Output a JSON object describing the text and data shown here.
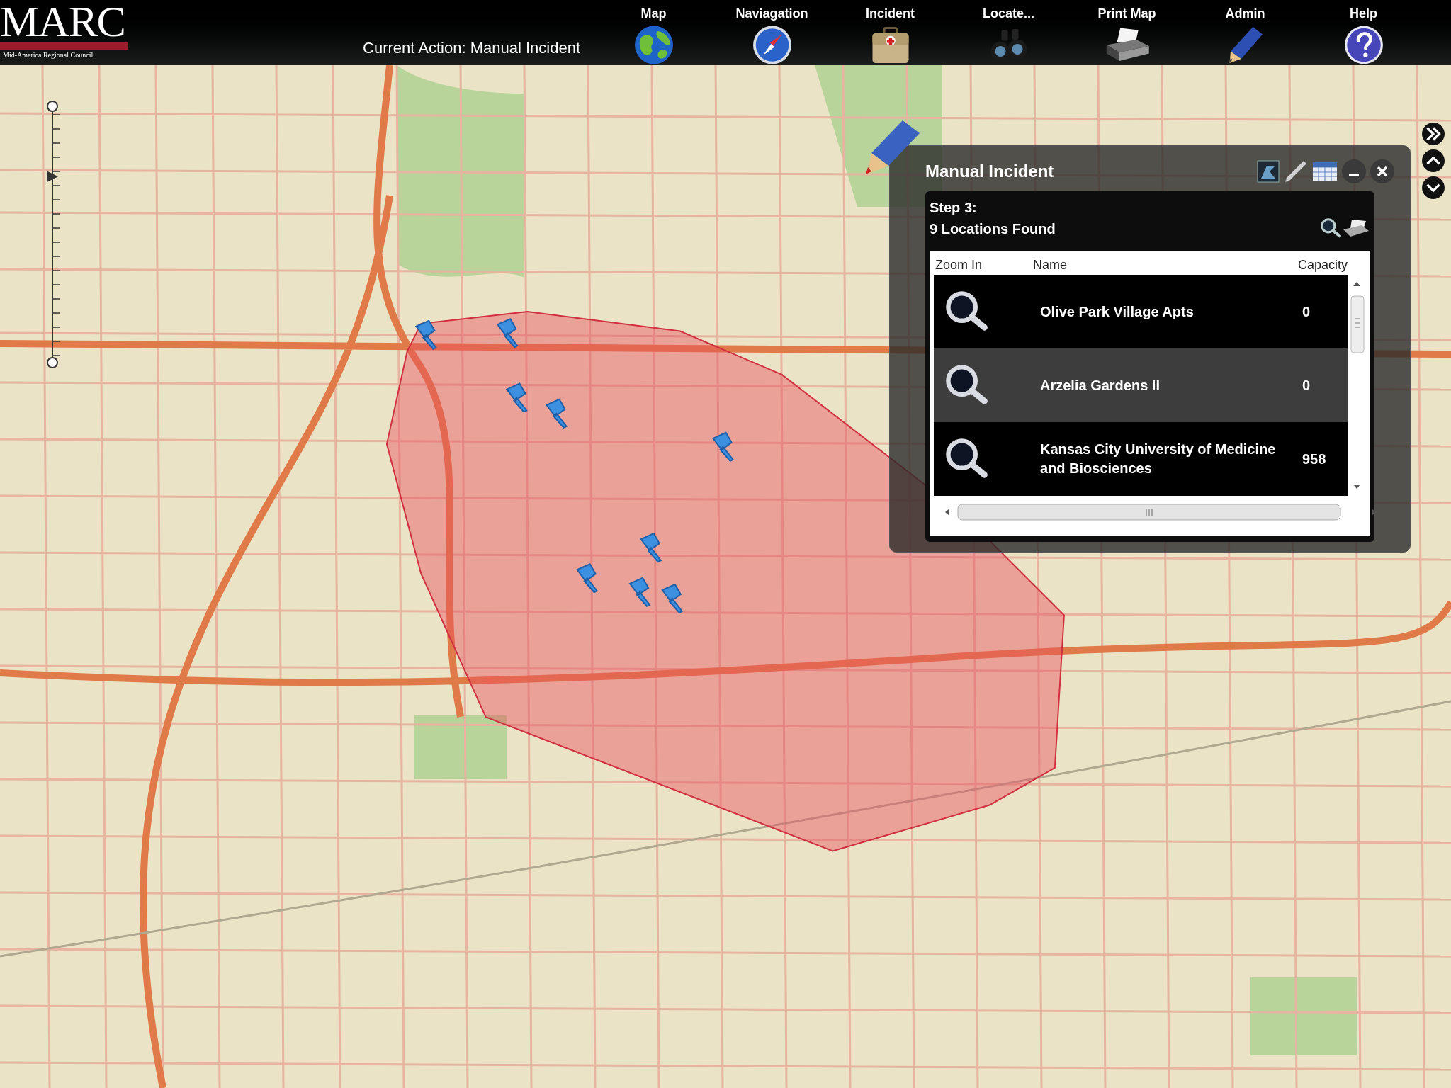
{
  "header": {
    "logo": {
      "title": "MARC",
      "subtitle": "Mid-America Regional Council"
    },
    "current_action": "Current Action: Manual Incident",
    "nav": [
      {
        "label": "Map",
        "kind": "globe"
      },
      {
        "label": "Naviagation",
        "kind": "compass"
      },
      {
        "label": "Incident",
        "kind": "kit"
      },
      {
        "label": "Locate...",
        "kind": "binoculars"
      },
      {
        "label": "Print Map",
        "kind": "printer"
      },
      {
        "label": "Admin",
        "kind": "pencil"
      },
      {
        "label": "Help",
        "kind": "help"
      }
    ]
  },
  "zoom_slider": {
    "level": 0.73
  },
  "panel": {
    "title": "Manual Incident",
    "step": "Step 3:",
    "summary": "9 Locations Found",
    "table": {
      "columns": [
        "Zoom In",
        "Name",
        "Capacity"
      ],
      "rows": [
        {
          "name": "Olive Park Village Apts",
          "capacity": "0",
          "selected": false
        },
        {
          "name": "Arzelia Gardens II",
          "capacity": "0",
          "selected": true
        },
        {
          "name": "Kansas City University of Medicine and Biosciences",
          "capacity": "958",
          "selected": false
        }
      ]
    }
  }
}
